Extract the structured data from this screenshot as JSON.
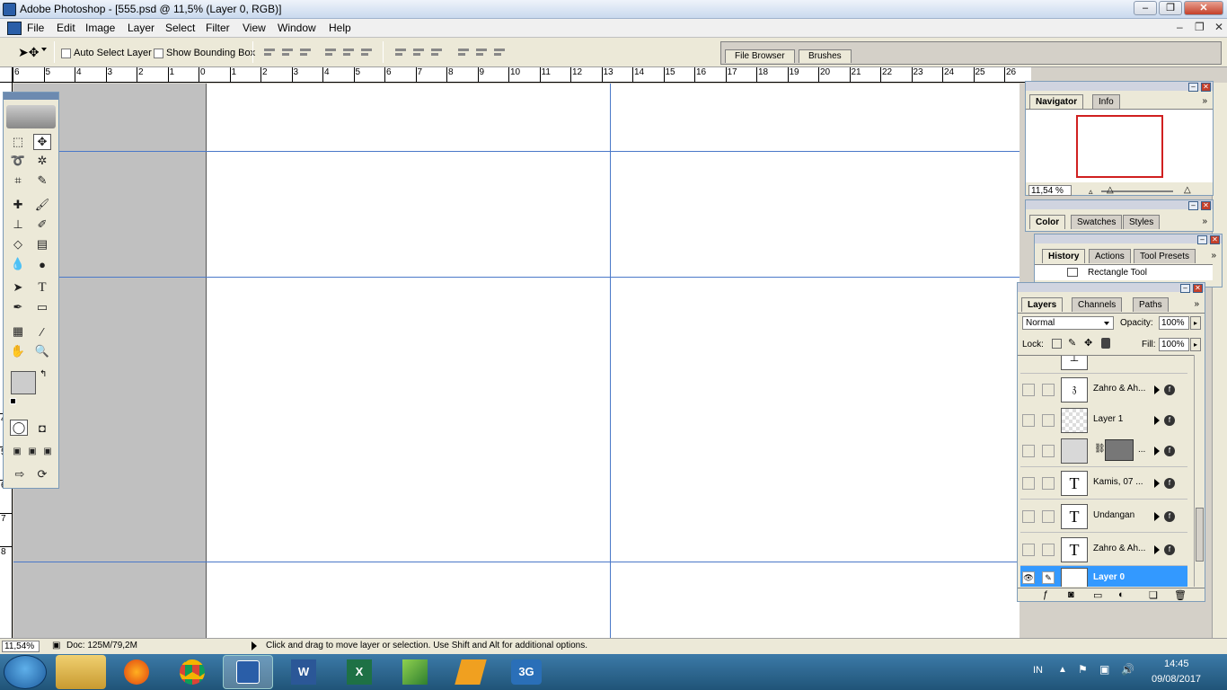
{
  "window": {
    "title": "Adobe Photoshop - [555.psd @ 11,5% (Layer 0, RGB)]",
    "controls": {
      "minimize": "–",
      "restore": "❐",
      "close": "✕"
    },
    "doc_controls": {
      "minimize": "–",
      "restore": "❐",
      "close": "✕"
    }
  },
  "menu": {
    "items": [
      "File",
      "Edit",
      "Image",
      "Layer",
      "Select",
      "Filter",
      "View",
      "Window",
      "Help"
    ]
  },
  "options": {
    "auto_select": "Auto Select Layer",
    "bounding_box": "Show Bounding Box",
    "well_tabs": [
      "File Browser",
      "Brushes"
    ]
  },
  "rulers": {
    "h_ticks": [
      "6",
      "5",
      "4",
      "3",
      "2",
      "1",
      "0",
      "1",
      "2",
      "3",
      "4",
      "5",
      "6",
      "7",
      "8",
      "9",
      "10",
      "11",
      "12",
      "13",
      "14",
      "15",
      "16",
      "17",
      "18",
      "19",
      "20",
      "21",
      "22",
      "23",
      "24",
      "25",
      "26"
    ],
    "v_ticks": [
      "4",
      "5",
      "6",
      "7",
      "8"
    ]
  },
  "navigator": {
    "tabs": [
      "Navigator",
      "Info"
    ],
    "zoom": "11,54 %"
  },
  "color_panel": {
    "tabs": [
      "Color",
      "Swatches",
      "Styles"
    ]
  },
  "history_panel": {
    "tabs": [
      "History",
      "Actions",
      "Tool Presets"
    ],
    "item": "Rectangle Tool"
  },
  "layers_panel": {
    "tabs": [
      "Layers",
      "Channels",
      "Paths"
    ],
    "blend_mode": "Normal",
    "opacity_label": "Opacity:",
    "opacity": "100%",
    "lock_label": "Lock:",
    "fill_label": "Fill:",
    "fill": "100%",
    "layers": [
      {
        "name": "Zahro & Ah...",
        "thumb": "𝔷"
      },
      {
        "name": "Layer 1",
        "thumb": ""
      },
      {
        "name": "...",
        "thumb": ""
      },
      {
        "name": "Kamis, 07 ...",
        "thumb": "T"
      },
      {
        "name": "Undangan",
        "thumb": "T"
      },
      {
        "name": "Zahro & Ah...",
        "thumb": "T"
      },
      {
        "name": "Layer 0",
        "thumb": ""
      }
    ]
  },
  "status": {
    "zoom": "11,54%",
    "doc": "Doc: 125M/79,2M",
    "hint": "Click and drag to move layer or selection.  Use Shift and Alt for additional options."
  },
  "taskbar": {
    "apps": [
      "explorer",
      "firefox",
      "chrome",
      "photoshop",
      "word",
      "excel",
      "app",
      "winamp",
      "3g"
    ],
    "app_labels": {
      "word": "W",
      "excel": "X",
      "3g": "3G"
    },
    "lang": "IN",
    "time": "14:45",
    "date": "09/08/2017"
  },
  "colors": {
    "guide": "#4a78c8",
    "selected_layer": "#3399ff",
    "canvas_bg": "#c0c0c0"
  }
}
